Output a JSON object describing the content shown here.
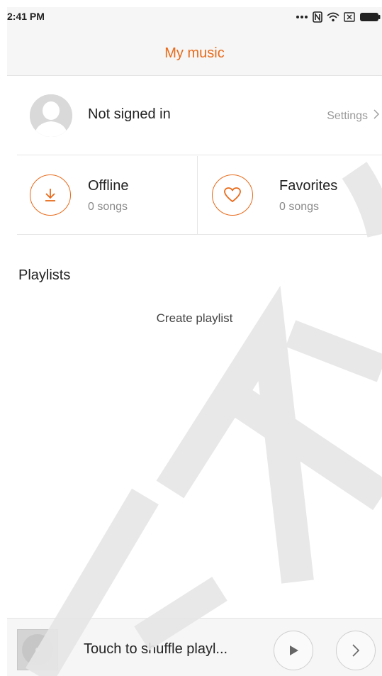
{
  "status_bar": {
    "time": "2:41 PM"
  },
  "header": {
    "title": "My music"
  },
  "profile": {
    "name": "Not signed in",
    "settings_label": "Settings"
  },
  "cards": [
    {
      "title": "Offline",
      "count": "0 songs",
      "icon": "download-icon"
    },
    {
      "title": "Favorites",
      "count": "0 songs",
      "icon": "heart-icon"
    }
  ],
  "playlists": {
    "section_title": "Playlists",
    "create_label": "Create playlist"
  },
  "player": {
    "text": "Touch to shuffle playl..."
  },
  "colors": {
    "accent": "#e86a1a",
    "watermark": "#e8e8e8",
    "muted": "#9a9a9a"
  }
}
